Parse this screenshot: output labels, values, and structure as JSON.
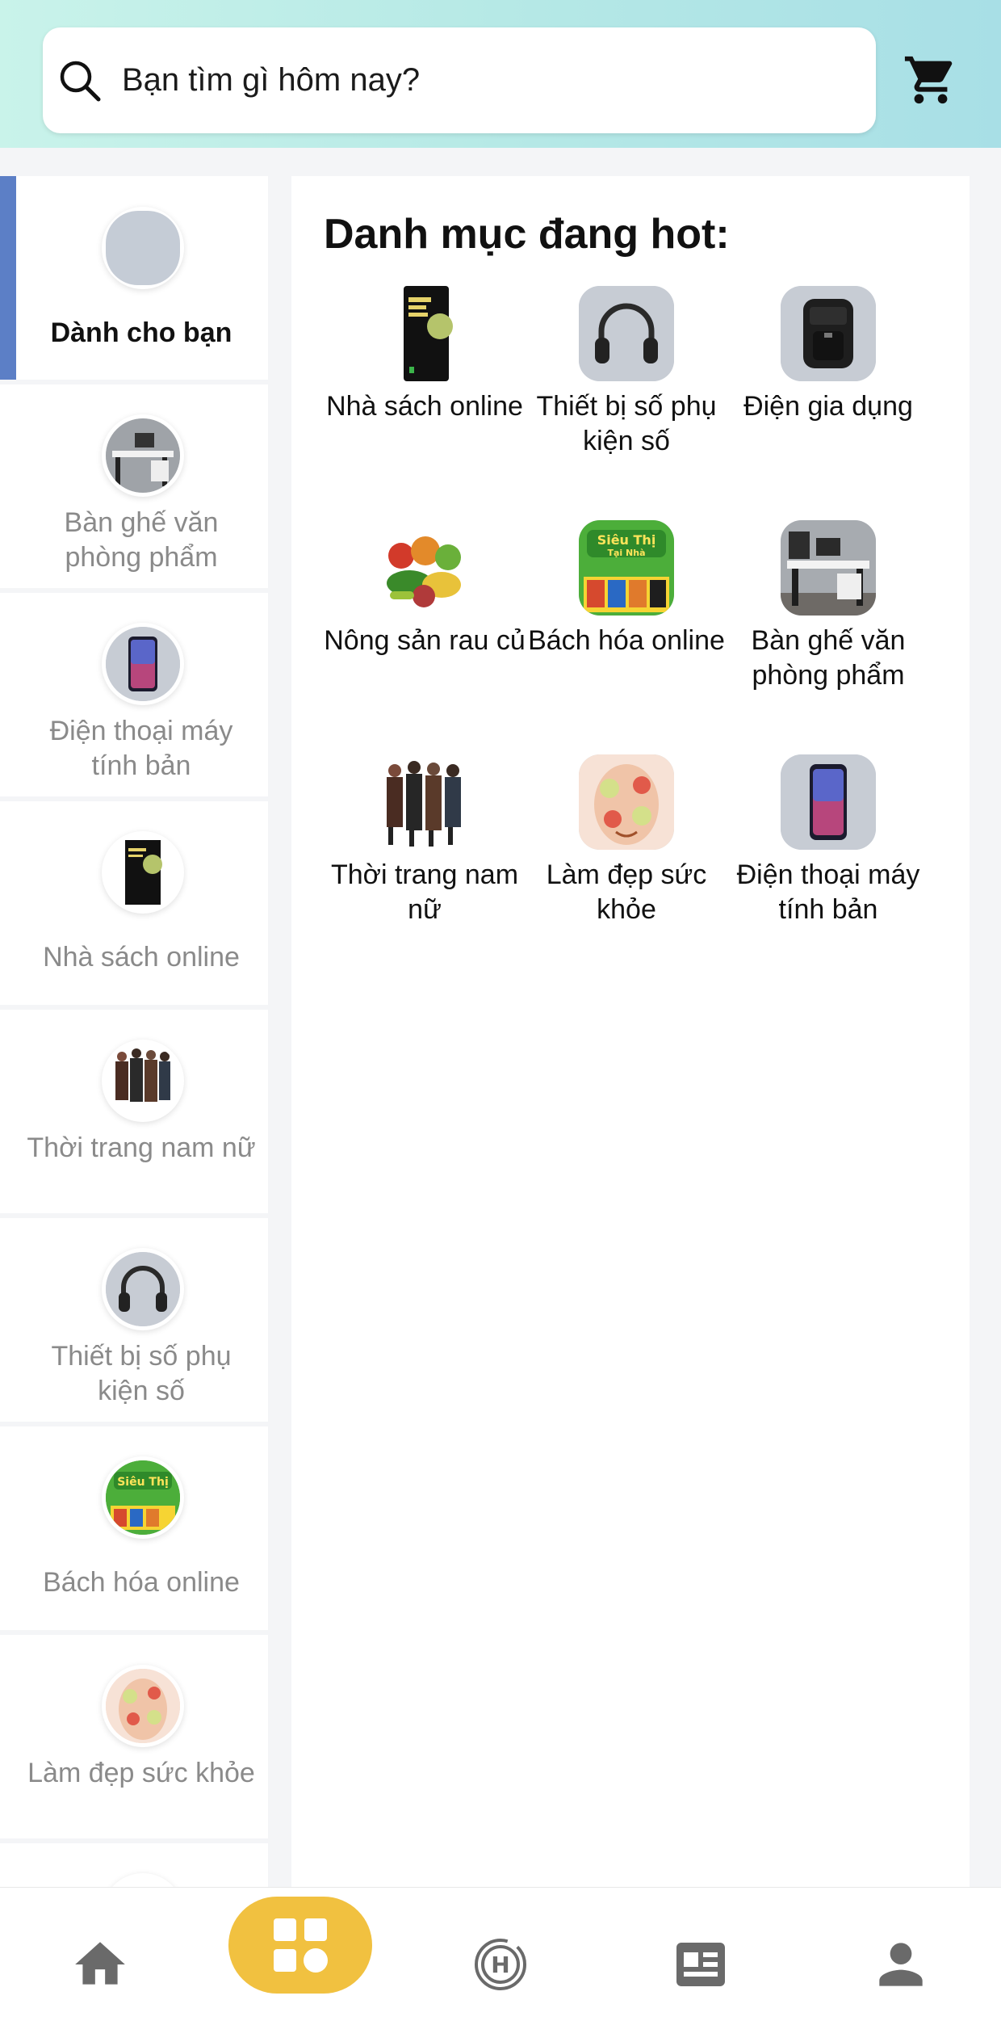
{
  "search": {
    "placeholder": "Bạn tìm gì hôm nay?"
  },
  "header": {
    "cart_icon": "cart-icon",
    "search_icon": "search-icon"
  },
  "sidebar": {
    "items": [
      {
        "label": "Dành cho bạn",
        "active": true
      },
      {
        "label": "Bàn ghế văn phòng phẩm"
      },
      {
        "label": "Điện thoại máy tính bản"
      },
      {
        "label": "Nhà sách online"
      },
      {
        "label": "Thời trang nam nữ"
      },
      {
        "label": "Thiết bị số phụ kiện số"
      },
      {
        "label": "Bách hóa online"
      },
      {
        "label": "Làm đẹp sức khỏe"
      }
    ]
  },
  "main": {
    "title": "Danh mục đang hot:",
    "categories": [
      {
        "label": "Nhà sách online"
      },
      {
        "label": "Thiết bị số phụ kiện số"
      },
      {
        "label": "Điện gia dụng"
      },
      {
        "label": "Nông sản rau củ"
      },
      {
        "label": "Bách hóa online"
      },
      {
        "label": "Bàn ghế văn phòng phẩm"
      },
      {
        "label": "Thời trang nam nữ"
      },
      {
        "label": "Làm đẹp sức khỏe"
      },
      {
        "label": "Điện thoại máy tính bản"
      }
    ]
  },
  "bottom_nav": {
    "items": [
      "home-icon",
      "categories-icon",
      "history-icon",
      "news-icon",
      "account-icon"
    ],
    "active_index": 1
  },
  "colors": {
    "active_indicator": "#5c7fc6",
    "nav_active": "#f1c140"
  }
}
